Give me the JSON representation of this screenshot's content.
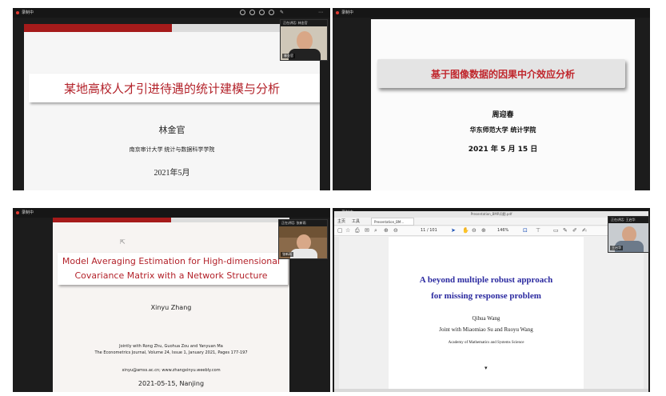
{
  "panels": [
    {
      "rec_label": "录制中",
      "cam_bar": "正在讲话: 林金官",
      "cam_name": "林金官",
      "title": "某地高校人才引进待遇的统计建模与分析",
      "author": "林金官",
      "affiliation": "南京审计大学   统计与数据科学学院",
      "date": "2021年5月"
    },
    {
      "rec_label": "录制中",
      "title": "基于图像数据的因果中介效应分析",
      "author": "周迎春",
      "affiliation": "华东师范大学  统计学院",
      "date": "2021  年  5  月  15  日"
    },
    {
      "rec_label": "录制中",
      "cam_bar": "正在讲话: 张新雨",
      "cam_name": "张新雨",
      "title_line1": "Model Averaging Estimation for High-dimensional",
      "title_line2": "Covariance Matrix with a Network Structure",
      "author": "Xinyu Zhang",
      "jointly": "Jointly with Rong Zhu, Guohua Zou and Yanyuan Ma",
      "journal": "The Econometrics Journal, Volume 24, Issue 1, January 2021, Pages 177-197",
      "contact": "xinyu@amss.ac.cn;  www.zhangxinyu.weebly.com",
      "date": "2021-05-15, Nanjing"
    },
    {
      "rec_label": "录制中",
      "cam_bar": "正在讲话: 王启华",
      "cam_name": "王启华",
      "window_title": "Presentation_BMR问题.pdf",
      "menu_home": "主页",
      "menu_tools": "工具",
      "tab_label": "Presentation_BM...",
      "page_indicator": "11 / 101",
      "zoom": "146%",
      "title_line1": "A beyond multiple robust approach",
      "title_line2": "for missing response problem",
      "author": "Qihua Wang",
      "joint": "Joint with Miaomiao Su and Ruoyu Wang",
      "affiliation": "Academy of Mathematics and Systems Science"
    }
  ],
  "colors": {
    "red_accent": "#b3222a",
    "dark_red_bar": "#a61b1b",
    "blue_title": "#2b2aa0"
  },
  "icons": [
    "zoom-in-icon",
    "zoom-out-icon",
    "search-icon",
    "info-icon",
    "more-icon",
    "expand-icon",
    "home-icon",
    "star-icon",
    "print-icon",
    "mail-icon",
    "cursor-icon",
    "hand-icon",
    "comment-icon",
    "pen-icon"
  ]
}
